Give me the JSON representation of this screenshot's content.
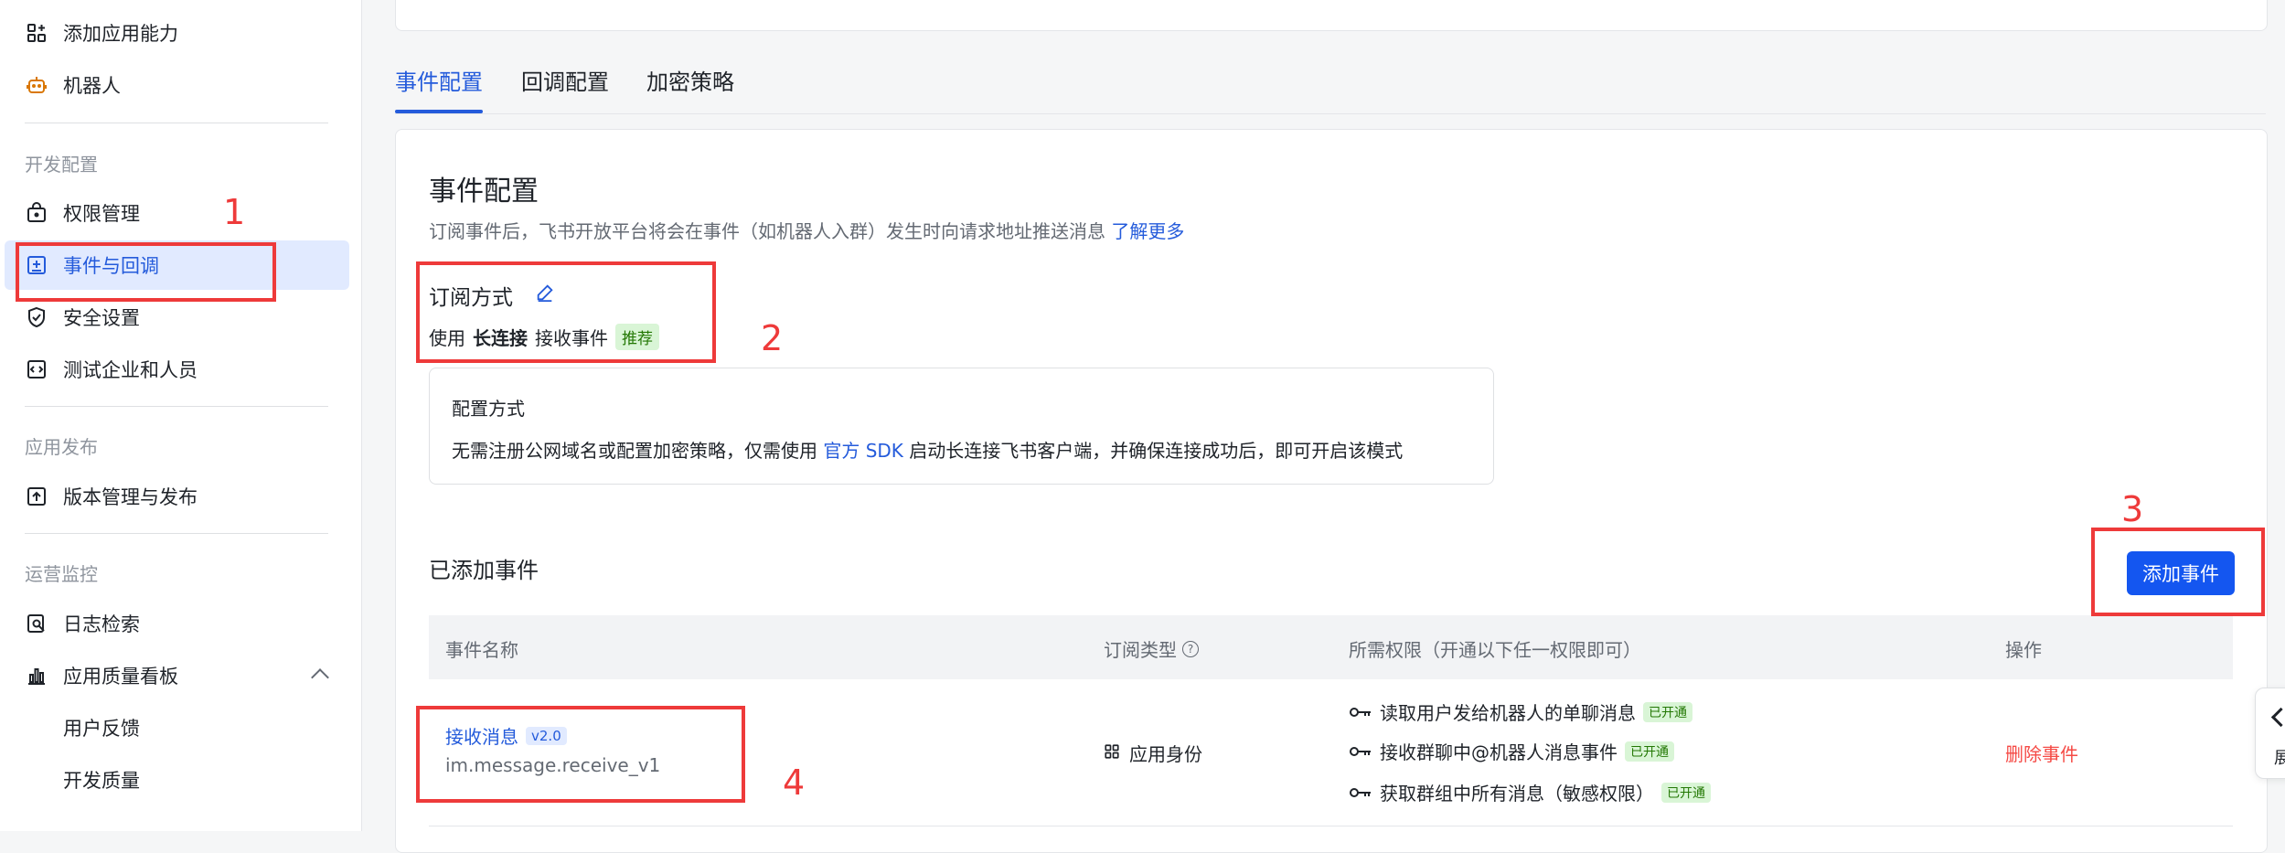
{
  "sidebar": {
    "items": [
      {
        "label": "添加应用能力",
        "icon": "grid-plus-icon"
      },
      {
        "label": "机器人",
        "icon": "robot-icon"
      },
      {
        "label": "权限管理",
        "icon": "lock-box-icon"
      },
      {
        "label": "事件与回调",
        "icon": "event-plus-icon"
      },
      {
        "label": "安全设置",
        "icon": "shield-check-icon"
      },
      {
        "label": "测试企业和人员",
        "icon": "code-box-icon"
      },
      {
        "label": "版本管理与发布",
        "icon": "upload-box-icon"
      },
      {
        "label": "日志检索",
        "icon": "log-search-icon"
      },
      {
        "label": "应用质量看板",
        "icon": "bar-chart-icon"
      },
      {
        "label": "用户反馈"
      },
      {
        "label": "开发质量"
      }
    ],
    "sections": {
      "dev": "开发配置",
      "publish": "应用发布",
      "ops": "运营监控"
    }
  },
  "tabs": [
    "事件配置",
    "回调配置",
    "加密策略"
  ],
  "event_config": {
    "title": "事件配置",
    "desc": "订阅事件后，飞书开放平台将会在事件（如机器人入群）发生时向请求地址推送消息",
    "learn_more": "了解更多",
    "subscribe_title": "订阅方式",
    "use_prefix": "使用",
    "use_mode": "长连接",
    "use_suffix": "接收事件",
    "recommend_tag": "推荐",
    "config_box": {
      "title": "配置方式",
      "desc_before": "无需注册公网域名或配置加密策略，仅需使用",
      "sdk_link": "官方 SDK",
      "desc_after": "启动长连接飞书客户端，并确保连接成功后，即可开启该模式"
    }
  },
  "added_events": {
    "title": "已添加事件",
    "add_button": "添加事件",
    "columns": [
      "事件名称",
      "订阅类型",
      "所需权限（开通以下任一权限即可）",
      "操作"
    ],
    "rows": [
      {
        "name": "接收消息",
        "version": "v2.0",
        "key": "im.message.receive_v1",
        "type": "应用身份",
        "permissions": [
          {
            "label": "读取用户发给机器人的单聊消息",
            "status": "已开通"
          },
          {
            "label": "接收群聊中@机器人消息事件",
            "status": "已开通"
          },
          {
            "label": "获取群组中所有消息（敏感权限）",
            "status": "已开通"
          }
        ],
        "action": "删除事件"
      }
    ]
  },
  "annotations": [
    "1",
    "2",
    "3",
    "4"
  ],
  "float_tab": {
    "label": "展"
  },
  "colors": {
    "accent": "#245bdb",
    "button": "#1456f0",
    "danger": "#f54a45",
    "annotation": "#ee3a3a"
  }
}
